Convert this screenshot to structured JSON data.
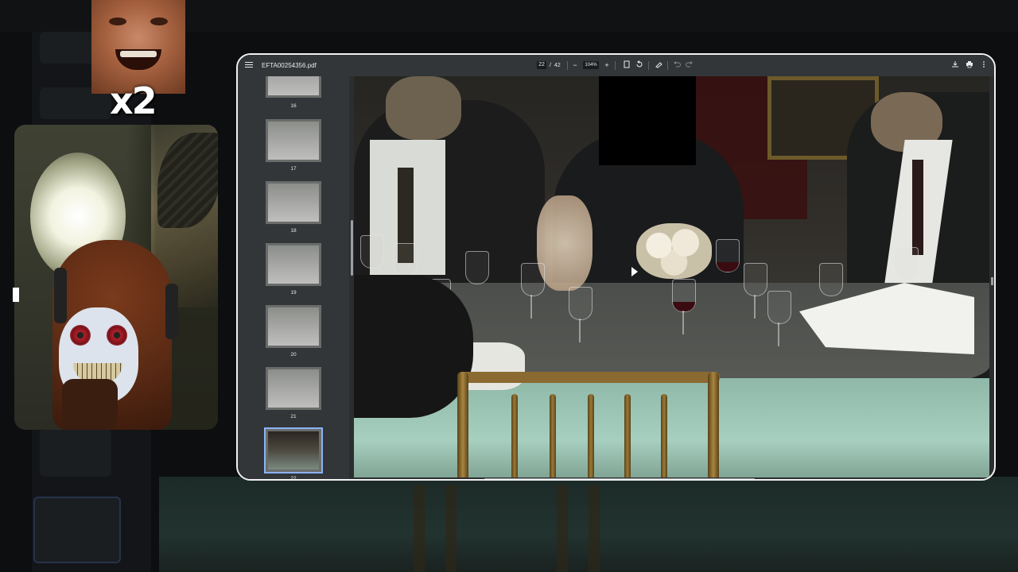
{
  "overlay": {
    "multiplier_text": "x2"
  },
  "pdf_viewer": {
    "file_name": "EFTA00254356.pdf",
    "current_page": "22",
    "page_separator": "/",
    "total_pages": "42",
    "zoom": "104%",
    "toolbar_icons": [
      "menu-icon",
      "zoom-out-icon",
      "zoom-in-icon",
      "fit-page-icon",
      "rotate-icon",
      "annotate-icon",
      "undo-icon",
      "redo-icon",
      "download-icon",
      "print-icon",
      "more-icon"
    ],
    "zoom_out_label": "−",
    "zoom_in_label": "+",
    "thumbnails": [
      {
        "label": "16",
        "active": false
      },
      {
        "label": "17",
        "active": false
      },
      {
        "label": "18",
        "active": false
      },
      {
        "label": "19",
        "active": false
      },
      {
        "label": "20",
        "active": false
      },
      {
        "label": "21",
        "active": false
      },
      {
        "label": "22",
        "active": true
      }
    ],
    "accent_color": "#8ab4f8",
    "toolbar_color": "#323639"
  }
}
